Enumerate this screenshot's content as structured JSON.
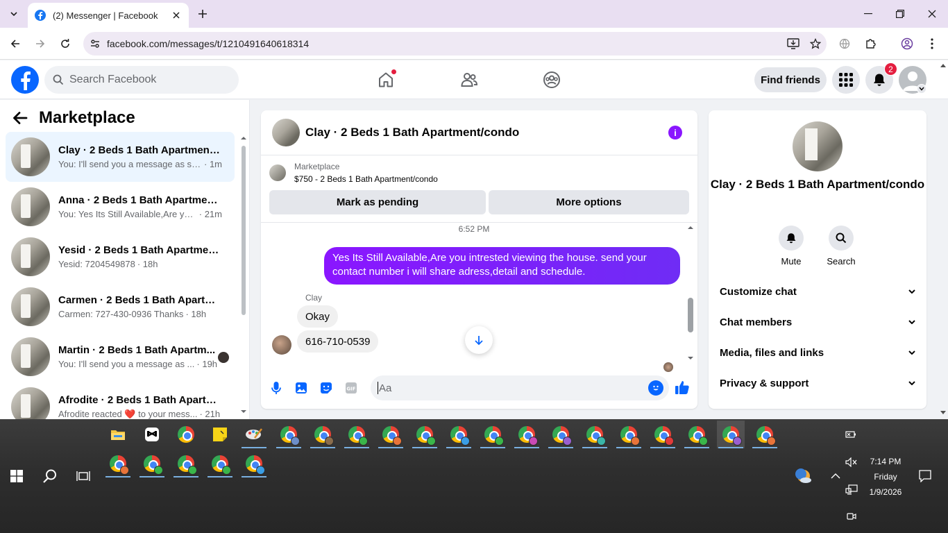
{
  "browser": {
    "tab_title": "(2) Messenger | Facebook",
    "url": "facebook.com/messages/t/1210491640618314"
  },
  "fb": {
    "search_placeholder": "Search Facebook",
    "find_friends": "Find friends",
    "notification_count": "2"
  },
  "sidebar": {
    "title": "Marketplace",
    "conversations": [
      {
        "name": "Clay · 2 Beds 1 Bath Apartment/...",
        "snippet": "You: I'll send you a message as so...",
        "time": "· 1m"
      },
      {
        "name": "Anna · 2 Beds 1 Bath Apartment...",
        "snippet": "You: Yes Its Still Available,Are you ...",
        "time": "· 21m"
      },
      {
        "name": "Yesid · 2 Beds 1 Bath Apartment...",
        "snippet": "Yesid: 7204549878",
        "time": "· 18h"
      },
      {
        "name": "Carmen · 2 Beds 1 Bath Apartme...",
        "snippet": "Carmen: 727-430-0936 Thanks",
        "time": "· 18h"
      },
      {
        "name": "Martin · 2 Beds 1 Bath Apartm...",
        "snippet": "You: I'll send you a message as ...",
        "time": "· 19h"
      },
      {
        "name": "Afrodite · 2 Beds 1 Bath Apartm...",
        "snippet": "Afrodite reacted ❤️ to your mess...",
        "time": "· 21h"
      }
    ]
  },
  "chat": {
    "title": "Clay · 2 Beds 1 Bath Apartment/condo",
    "marketplace_label": "Marketplace",
    "listing": "$750 - 2 Beds 1 Bath Apartment/condo",
    "mark_pending": "Mark as pending",
    "more_options": "More options",
    "timestamp": "6:52 PM",
    "outgoing_message": "Yes Its Still Available,Are you intrested viewing the house. send your contact number i will share adress,detail and schedule.",
    "sender_name": "Clay",
    "incoming_1": "Okay",
    "incoming_2": "616-710-0539",
    "composer_placeholder": "Aa"
  },
  "info_panel": {
    "name": "Clay · 2 Beds 1 Bath Apartment/condo",
    "mute": "Mute",
    "search": "Search",
    "rows": [
      "Customize chat",
      "Chat members",
      "Media, files and links",
      "Privacy & support"
    ]
  },
  "taskbar": {
    "time": "7:14 PM",
    "day": "Friday",
    "date": "1/9/2026"
  }
}
